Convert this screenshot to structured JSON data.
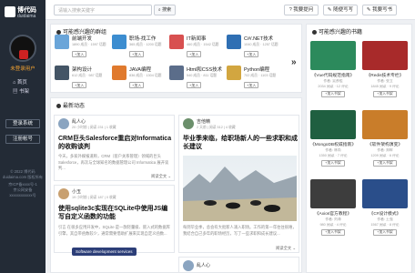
{
  "app": {
    "logo_cn": "博代码",
    "logo_en": "duidaima"
  },
  "sidebar": {
    "user_name": "未登录用户",
    "nav": [
      {
        "label": "首页"
      },
      {
        "label": "书架"
      }
    ],
    "login_label": "登录系统",
    "register_label": "注册帐号",
    "footer_lines": [
      "© 2022 博代码",
      "duidaima.com 版权所有",
      "京ICP备xxxx号-1",
      "京公网安备 xxxxxxxxxxxx号"
    ]
  },
  "header": {
    "search_placeholder": "请输入搜索关键字",
    "search_button": "搜索",
    "ask_button": "我要提问",
    "write_button": "随便写写",
    "post_button": "我要写书"
  },
  "groups_panel": {
    "title": "可能感兴趣的群组",
    "groups": [
      {
        "name": "前端开发",
        "meta": "1890 成员 · 1597 话题",
        "join": "+加入",
        "color": "#6aa5d9",
        "icon": "group-icon"
      },
      {
        "name": "职场-找工作",
        "meta": "365 成员 · 1200 话题",
        "join": "+加入",
        "color": "#3c8dd0",
        "icon": "group-icon"
      },
      {
        "name": "IT新闻事",
        "meta": "460 成员 · 1542 话题",
        "join": "+加入",
        "color": "#d85050",
        "icon": "group-icon"
      },
      {
        "name": "C#/.NET技术",
        "meta": "1040 成员 · 1257 话题",
        "join": "+加入",
        "color": "#2f6fb3",
        "icon": "dotnet-icon"
      },
      {
        "name": "架构设计",
        "meta": "612 成员 · 987 话题",
        "join": "+加入",
        "color": "#445566",
        "icon": "group-icon"
      },
      {
        "name": "JAVA编程",
        "meta": "836 成员 · 1304 话题",
        "join": "+加入",
        "color": "#e07a2e",
        "icon": "group-icon"
      },
      {
        "name": "Html和CSS技术",
        "meta": "540 成员 · 811 话题",
        "join": "+加入",
        "color": "#5b6d8a",
        "icon": "group-icon"
      },
      {
        "name": "Python编程",
        "meta": "702 成员 · 1103 话题",
        "join": "+加入",
        "color": "#d2a640",
        "icon": "group-icon"
      }
    ]
  },
  "books_panel": {
    "title": "可能感兴趣的书籍",
    "books": [
      {
        "title": "《Vue代码规范指南》",
        "author": "作者: 吴彦祖",
        "meta": "2034 阅读 · 12 评论",
        "join": "+加入书架",
        "color": "#2c8a5c"
      },
      {
        "title": "《Redis技术专栏》",
        "author": "作者: 张立",
        "meta": "1845 阅读 · 9 评论",
        "join": "+加入书架",
        "color": "#a82a2a"
      },
      {
        "title": "《MongoDB权威指南》",
        "author": "作者: 林尚",
        "meta": "1350 阅读 · 7 评论",
        "join": "+加入书架",
        "color": "#1f5f40"
      },
      {
        "title": "《软件架构演变》",
        "author": "作者: 郑辉",
        "meta": "1209 阅读 · 6 评论",
        "join": "+加入书架",
        "color": "#c97d2a"
      },
      {
        "title": "《Axios官方教程》",
        "author": "作者: 刘海",
        "meta": "980 阅读 · 4 评论",
        "join": "+加入书架",
        "color": "#3d3d3d"
      },
      {
        "title": "《C#设计模式》",
        "author": "作者: 王强",
        "meta": "1567 阅读 · 8 评论",
        "join": "+加入书架",
        "color": "#2a4e8a"
      }
    ]
  },
  "feed_panel": {
    "title": "最新动态",
    "cards": [
      {
        "user": "乱人心",
        "meta": "20 小时前 | 阅读 231 | 1 收藏",
        "title": "CRM巨头Salesforce重启对Informatica的收购谈判",
        "body": "今天，多家外媒报道称，CRM（客户关系管理）领域的巨头 Salesforce，再次与全球知名的数据管理公司 Informatica 展开谈判...",
        "more": "阅读全文"
      },
      {
        "user": "小玉",
        "meta": "19 小时前 | 阅读 187 | 0 收藏",
        "title": "使用sqlite3c实现在SQLite中使用JS编写自定义函数的功能",
        "body": "引言 在很多应用开发中，SQLite 是一款轻量级、嵌入式的数据库引擎，其自带函数较少，通常需要借助扩展来实现自定义函数...",
        "more": "阅读全文"
      },
      {
        "user": "吉他精",
        "meta": "2 天前 | 阅读 512 | 4 收藏",
        "title": "毕业季来临，给职场新人的一些求职和成长建议",
        "body": "每到毕业季，总会有大批新人涌入职场。工作的第一年往往很难，我结合自己多年的职场经历，写了一些求职和成长建议...",
        "more": "阅读全文"
      }
    ],
    "next_user": "乱人心"
  },
  "tooltip": "Software development services"
}
